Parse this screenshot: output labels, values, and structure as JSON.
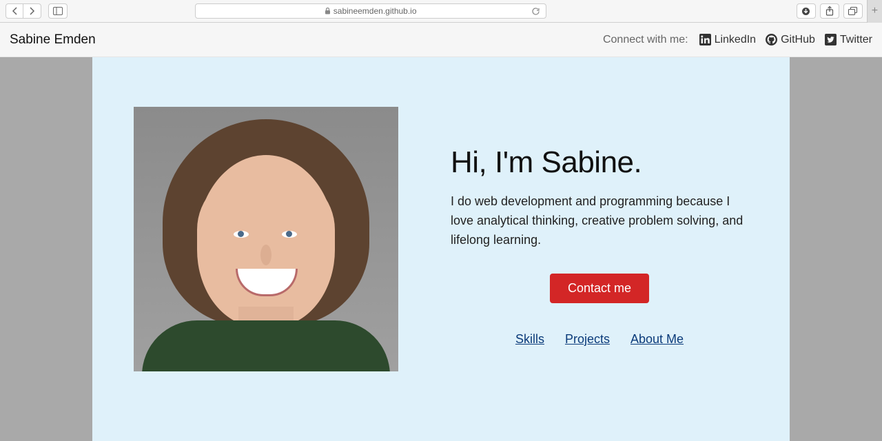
{
  "browser": {
    "url_display": "sabineemden.github.io"
  },
  "header": {
    "brand": "Sabine Emden",
    "connect_label": "Connect with me:",
    "social": [
      {
        "label": "LinkedIn"
      },
      {
        "label": "GitHub"
      },
      {
        "label": "Twitter"
      }
    ]
  },
  "hero": {
    "title": "Hi, I'm Sabine.",
    "body": "I do web development and programming because I love analytical thinking, creative problem solving, and lifelong learning.",
    "cta": "Contact me",
    "nav": [
      {
        "label": "Skills"
      },
      {
        "label": "Projects"
      },
      {
        "label": "About Me"
      }
    ]
  },
  "colors": {
    "accent": "#d32626",
    "link": "#0b3b7a",
    "page_bg": "#dff1fa"
  }
}
